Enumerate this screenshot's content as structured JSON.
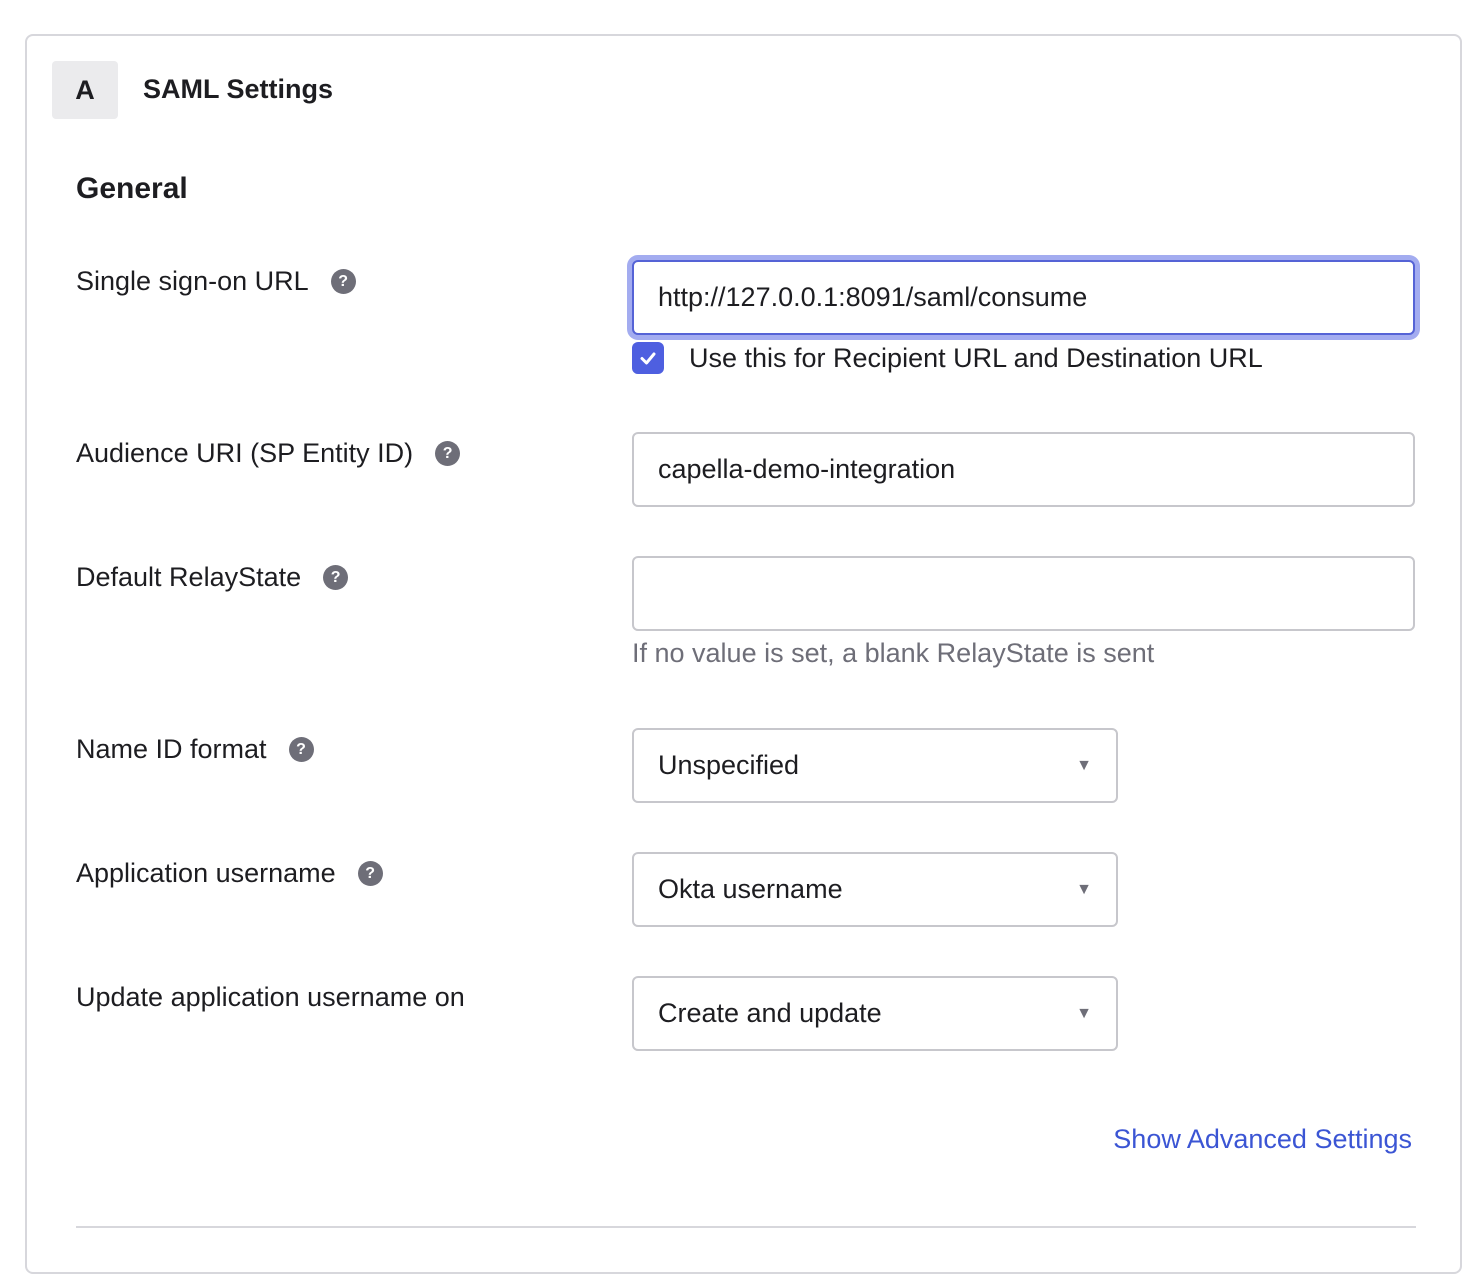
{
  "header": {
    "step": "A",
    "title": "SAML Settings"
  },
  "section": {
    "title": "General"
  },
  "fields": {
    "sso_url": {
      "label": "Single sign-on URL",
      "value": "http://127.0.0.1:8091/saml/consume",
      "checkbox_label": "Use this for Recipient URL and Destination URL",
      "checkbox_checked": true
    },
    "audience_uri": {
      "label": "Audience URI (SP Entity ID)",
      "value": "capella-demo-integration"
    },
    "relay_state": {
      "label": "Default RelayState",
      "value": "",
      "hint": "If no value is set, a blank RelayState is sent"
    },
    "name_id_format": {
      "label": "Name ID format",
      "value": "Unspecified"
    },
    "app_username": {
      "label": "Application username",
      "value": "Okta username"
    },
    "update_username_on": {
      "label": "Update application username on",
      "value": "Create and update"
    }
  },
  "links": {
    "advanced": "Show Advanced Settings"
  },
  "icons": {
    "help": "?",
    "caret": "▼"
  },
  "colors": {
    "accent": "#4e5fe0",
    "link": "#3b55d4",
    "focus_ring": "#a3acf0"
  }
}
